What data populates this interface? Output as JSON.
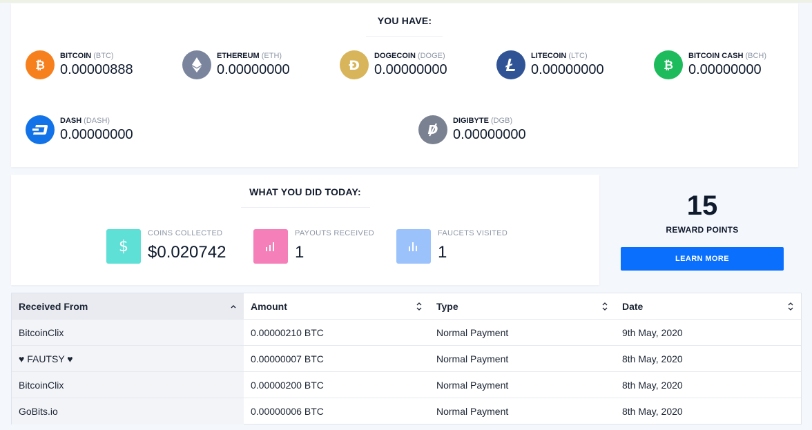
{
  "holdings": {
    "title": "YOU HAVE:",
    "coins": [
      {
        "name": "BITCOIN",
        "symbol": "(BTC)",
        "balance": "0.00000888",
        "icon": "bitcoin-icon",
        "color": "#f7801e"
      },
      {
        "name": "ETHEREUM",
        "symbol": "(ETH)",
        "balance": "0.00000000",
        "icon": "ethereum-icon",
        "color": "#7a859d"
      },
      {
        "name": "DOGECOIN",
        "symbol": "(DOGE)",
        "balance": "0.00000000",
        "icon": "dogecoin-icon",
        "color": "#d8b55a"
      },
      {
        "name": "LITECOIN",
        "symbol": "(LTC)",
        "balance": "0.00000000",
        "icon": "litecoin-icon",
        "color": "#2f5395"
      },
      {
        "name": "BITCOIN CASH",
        "symbol": "(BCH)",
        "balance": "0.00000000",
        "icon": "bitcoin-cash-icon",
        "color": "#1dbb5b"
      },
      {
        "name": "DASH",
        "symbol": "(DASH)",
        "balance": "0.00000000",
        "icon": "dash-icon",
        "color": "#1272e7"
      },
      {
        "name": "DIGIBYTE",
        "symbol": "(DGB)",
        "balance": "0.00000000",
        "icon": "digibyte-icon",
        "color": "#7a8191"
      }
    ]
  },
  "today": {
    "title": "WHAT YOU DID TODAY:",
    "stats": [
      {
        "label": "COINS COLLECTED",
        "value": "$0.020742",
        "icon": "dollar-icon",
        "color": "#5ee0d6"
      },
      {
        "label": "PAYOUTS RECEIVED",
        "value": "1",
        "icon": "bar-chart-icon",
        "color": "#f57fb9"
      },
      {
        "label": "FAUCETS VISITED",
        "value": "1",
        "icon": "bar-chart-icon",
        "color": "#9cc2fb"
      }
    ]
  },
  "reward": {
    "points": "15",
    "label": "REWARD POINTS",
    "button_label": "LEARN MORE",
    "button_color": "#0b6ffd"
  },
  "payments": {
    "columns": [
      "Received From",
      "Amount",
      "Type",
      "Date"
    ],
    "rows": [
      [
        "BitcoinClix",
        "0.00000210 BTC",
        "Normal Payment",
        "9th May, 2020"
      ],
      [
        "♥ FAUTSY ♥",
        "0.00000007 BTC",
        "Normal Payment",
        "8th May, 2020"
      ],
      [
        "BitcoinClix",
        "0.00000200 BTC",
        "Normal Payment",
        "8th May, 2020"
      ],
      [
        "GoBits.io",
        "0.00000006 BTC",
        "Normal Payment",
        "8th May, 2020"
      ]
    ]
  }
}
